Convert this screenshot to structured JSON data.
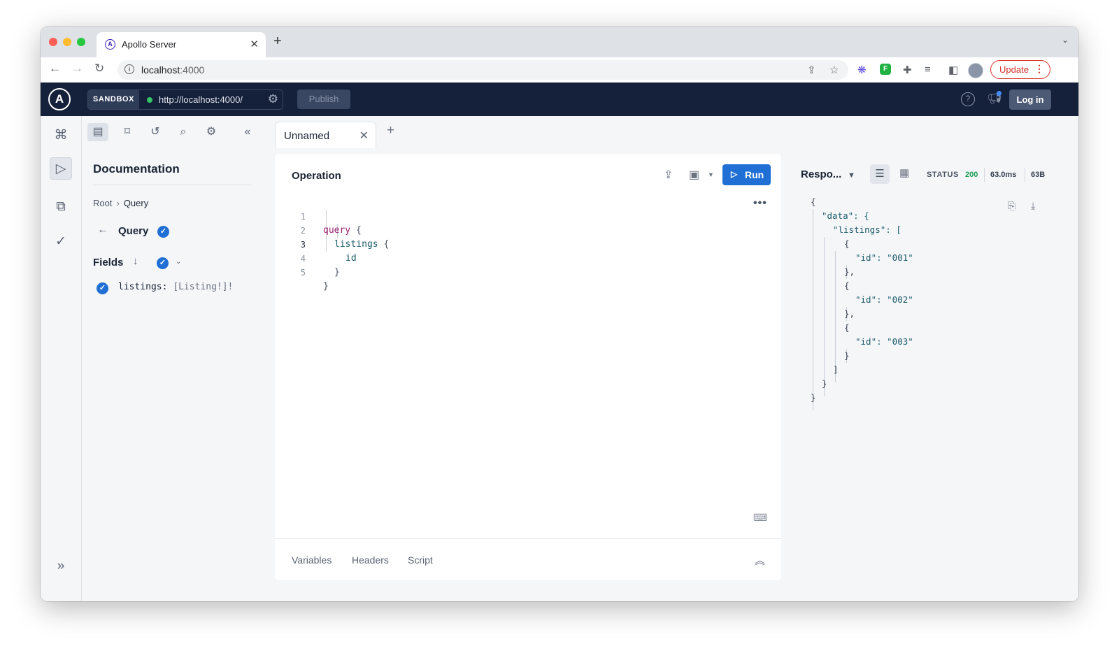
{
  "browser": {
    "tab_title": "Apollo Server",
    "favicon_letter": "A",
    "url_host": "localhost",
    "url_port": ":4000",
    "update_label": "Update",
    "new_tab_symbol": "+",
    "close_symbol": "✕"
  },
  "header": {
    "logo_letter": "A",
    "sandbox_label": "SANDBOX",
    "endpoint": "http://localhost:4000/",
    "publish_label": "Publish",
    "help_symbol": "?",
    "login_label": "Log in"
  },
  "docs": {
    "title": "Documentation",
    "breadcrumb": [
      "Root",
      "Query"
    ],
    "type_name": "Query",
    "fields_label": "Fields",
    "field": {
      "name": "listings:",
      "type": "[Listing!]!"
    }
  },
  "operation": {
    "tab_label": "Unnamed",
    "title": "Operation",
    "run_label": "Run",
    "code_lines": [
      {
        "num": "1",
        "kw": "query",
        "rest": " {"
      },
      {
        "num": "2",
        "field": "listings",
        "rest": " {"
      },
      {
        "num": "3",
        "field": "id",
        "rest": ""
      },
      {
        "num": "4",
        "field": "",
        "rest": "}"
      },
      {
        "num": "5",
        "field": "",
        "rest": "}"
      }
    ],
    "footer_tabs": [
      "Variables",
      "Headers",
      "Script"
    ]
  },
  "response": {
    "title": "Respo...",
    "status_label": "STATUS",
    "status_code": "200",
    "time": "63.0ms",
    "size": "63B",
    "json_lines": [
      "{",
      "\"data\": {",
      "\"listings\": [",
      "{",
      "\"id\": \"001\"",
      "},",
      "{",
      "\"id\": \"002\"",
      "},",
      "{",
      "\"id\": \"003\"",
      "}",
      "]",
      "}",
      "}"
    ]
  }
}
